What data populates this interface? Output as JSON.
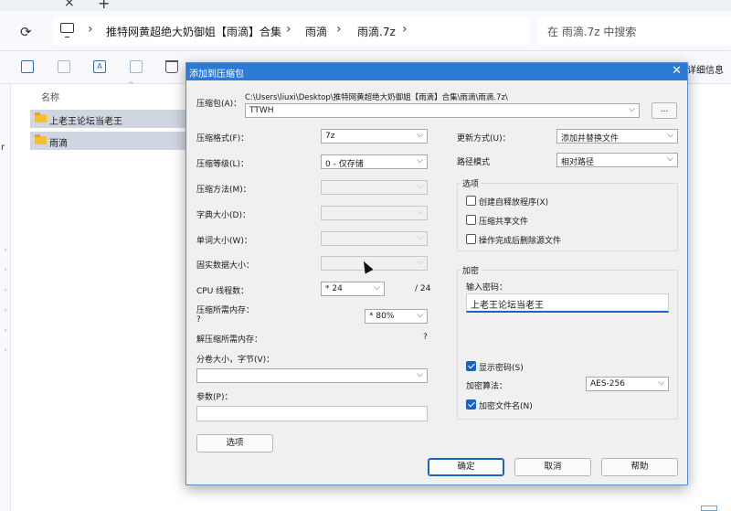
{
  "explorer": {
    "breadcrumbs": [
      "推特网黄超绝大奶御姐【雨滴】合集",
      "雨滴",
      "雨滴.7z"
    ],
    "search_placeholder": "在 雨滴.7z 中搜索",
    "toolbar_details": "详细信息",
    "left_letter": "r",
    "column_name": "名称",
    "files": [
      {
        "name": "上老王论坛当老王",
        "icon": "folder-icon"
      },
      {
        "name": "雨滴",
        "icon": "folder-icon"
      }
    ]
  },
  "dialog": {
    "title": "添加到压缩包",
    "archive_label": "压缩包(A)：",
    "archive_path": "C:\\Users\\liuxi\\Desktop\\推特网黄超绝大奶御姐【雨滴】合集\\雨滴\\雨滴.7z\\",
    "archive_name": "TTWH",
    "browse_label": "...",
    "left": {
      "format_label": "压缩格式(F)：",
      "format_value": "7z",
      "level_label": "压缩等级(L)：",
      "level_value": "0 - 仅存储",
      "method_label": "压缩方法(M)：",
      "dict_label": "字典大小(D)：",
      "word_label": "单词大小(W)：",
      "solid_label": "固实数据大小：",
      "cpu_label": "CPU 线程数：",
      "cpu_value": "* 24",
      "cpu_total": "/ 24",
      "mem_comp_label": "压缩所需内存：",
      "mem_comp_q": "?",
      "mem_comp_value": "* 80%",
      "mem_decomp_label": "解压缩所需内存：",
      "mem_decomp_value": "?",
      "split_label": "分卷大小，字节(V)：",
      "params_label": "参数(P)：",
      "options_button": "选项"
    },
    "right": {
      "update_label": "更新方式(U)：",
      "update_value": "添加并替换文件",
      "path_label": "路径模式",
      "path_value": "相对路径",
      "options_group": "选项",
      "sfx_label": "创建自释放程序(X)",
      "shared_label": "压缩共享文件",
      "delete_label": "操作完成后删除源文件",
      "encrypt_group": "加密",
      "password_label": "输入密码：",
      "password_value": "上老王论坛当老王",
      "show_password_label": "显示密码(S)",
      "enc_method_label": "加密算法：",
      "enc_method_value": "AES-256",
      "encrypt_names_label": "加密文件名(N)"
    },
    "buttons": {
      "ok": "确定",
      "cancel": "取消",
      "help": "帮助"
    },
    "checkbox_state": {
      "sfx": false,
      "shared": false,
      "delete": false,
      "show_password": true,
      "encrypt_names": true
    }
  },
  "colors": {
    "title_bar": "#2d7ad6",
    "checkbox_on": "#1a63c6",
    "folder": "#f4c12e"
  }
}
